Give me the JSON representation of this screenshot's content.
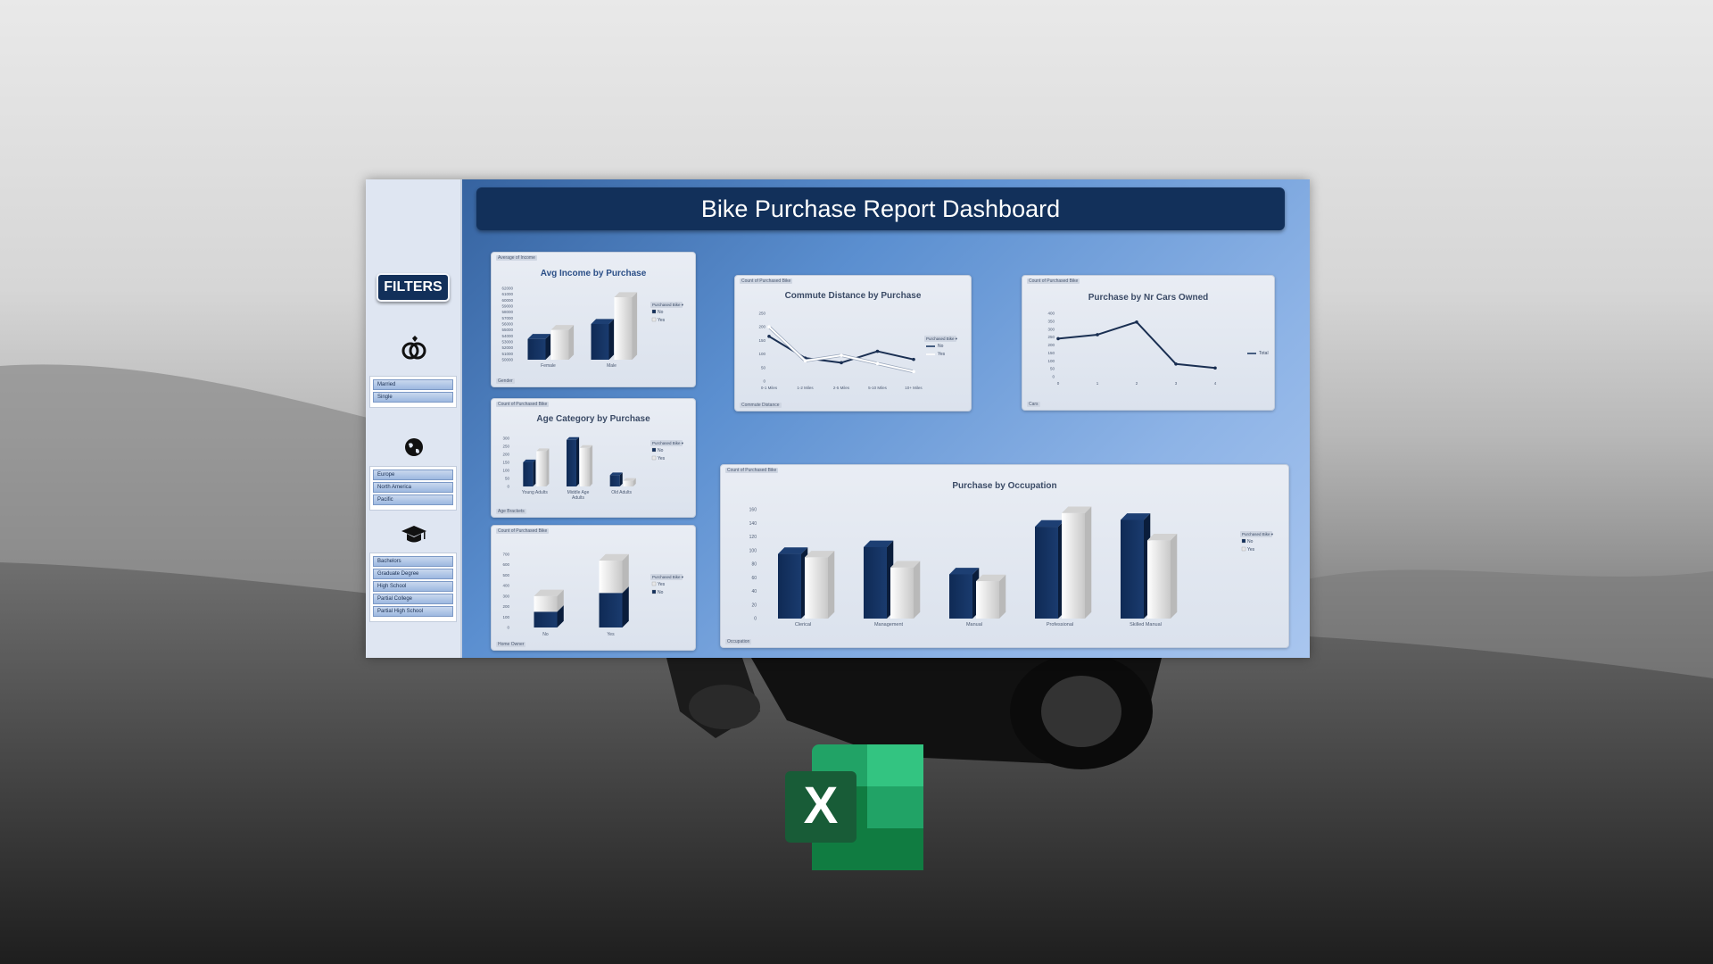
{
  "dashboard": {
    "title": "Bike Purchase Report Dashboard",
    "filters_label": "FILTERS"
  },
  "slicers": {
    "marital": [
      "Married",
      "Single"
    ],
    "region": [
      "Europe",
      "North America",
      "Pacific"
    ],
    "education": [
      "Bachelors",
      "Graduate Degree",
      "High School",
      "Partial College",
      "Partial High School"
    ]
  },
  "icons": {
    "marital": "rings-icon",
    "region": "globe-icon",
    "education": "graduation-cap-icon",
    "app": "excel-logo-icon"
  },
  "colors": {
    "navy": "#12305a",
    "bar_no": "#13305c",
    "bar_yes": "#e8e8e8"
  },
  "cards": {
    "income": {
      "title": "Avg Income by Purchase",
      "field": "Average of Income",
      "axis_button": "Gender",
      "legend_title": "Purchased Bike",
      "legend": [
        "No",
        "Yes"
      ]
    },
    "age": {
      "title": "Age Category by Purchase",
      "field": "Count of Purchased Bike",
      "axis_button": "Age Brackets",
      "legend_title": "Purchased Bike",
      "legend": [
        "No",
        "Yes"
      ]
    },
    "home": {
      "field": "Count of Purchased Bike",
      "axis_button": "Home Owner",
      "legend_title": "Purchased Bike",
      "legend": [
        "Yes",
        "No"
      ]
    },
    "commute": {
      "title": "Commute Distance by Purchase",
      "field": "Count of Purchased Bike",
      "axis_button": "Commute Distance",
      "legend_title": "Purchased Bike",
      "legend": [
        "No",
        "Yes"
      ]
    },
    "cars": {
      "title": "Purchase by Nr Cars Owned",
      "field": "Count of Purchased Bike",
      "axis_button": "Cars",
      "legend": [
        "Total"
      ]
    },
    "occupation": {
      "title": "Purchase by Occupation",
      "field": "Count of Purchased Bike",
      "axis_button": "Occupation",
      "legend_title": "Purchased Bike",
      "legend": [
        "No",
        "Yes"
      ]
    }
  },
  "chart_data": [
    {
      "id": "income",
      "type": "bar",
      "title": "Avg Income by Purchase",
      "categories": [
        "Female",
        "Male"
      ],
      "series": [
        {
          "name": "No",
          "values": [
            53500,
            56000
          ]
        },
        {
          "name": "Yes",
          "values": [
            55000,
            60500
          ]
        }
      ],
      "ylim": [
        50000,
        62000
      ],
      "yticks": [
        "50000",
        "51000",
        "52000",
        "53000",
        "54000",
        "55000",
        "56000",
        "57000",
        "58000",
        "59000",
        "60000",
        "61000",
        "62000"
      ]
    },
    {
      "id": "age",
      "type": "bar",
      "title": "Age Category by Purchase",
      "categories": [
        "Young Adults",
        "Middle Age Adults",
        "Old Adults"
      ],
      "series": [
        {
          "name": "No",
          "values": [
            150,
            290,
            70
          ]
        },
        {
          "name": "Yes",
          "values": [
            220,
            240,
            35
          ]
        }
      ],
      "ylim": [
        0,
        300
      ],
      "yticks": [
        "0",
        "50",
        "100",
        "150",
        "200",
        "250",
        "300"
      ]
    },
    {
      "id": "home",
      "type": "bar",
      "stacked": true,
      "categories": [
        "No",
        "Yes"
      ],
      "series": [
        {
          "name": "No",
          "values": [
            150,
            330
          ]
        },
        {
          "name": "Yes",
          "values": [
            150,
            310
          ]
        }
      ],
      "ylim": [
        0,
        700
      ],
      "yticks": [
        "0",
        "100",
        "200",
        "300",
        "400",
        "500",
        "600",
        "700"
      ]
    },
    {
      "id": "commute",
      "type": "line",
      "title": "Commute Distance by Purchase",
      "categories": [
        "0-1 Miles",
        "1-2 Miles",
        "2-5 Miles",
        "5-10 Miles",
        "10+ Miles"
      ],
      "series": [
        {
          "name": "No",
          "values": [
            165,
            85,
            68,
            110,
            80
          ]
        },
        {
          "name": "Yes",
          "values": [
            200,
            75,
            95,
            65,
            35
          ]
        }
      ],
      "ylim": [
        0,
        250
      ],
      "yticks": [
        "0",
        "50",
        "100",
        "150",
        "200",
        "250"
      ]
    },
    {
      "id": "cars",
      "type": "line",
      "title": "Purchase by Nr Cars Owned",
      "categories": [
        "0",
        "1",
        "2",
        "3",
        "4"
      ],
      "series": [
        {
          "name": "Total",
          "values": [
            240,
            265,
            345,
            80,
            55
          ]
        }
      ],
      "ylim": [
        0,
        400
      ],
      "yticks": [
        "0",
        "50",
        "100",
        "150",
        "200",
        "250",
        "300",
        "350",
        "400"
      ]
    },
    {
      "id": "occupation",
      "type": "bar",
      "title": "Purchase by Occupation",
      "categories": [
        "Clerical",
        "Management",
        "Manual",
        "Professional",
        "Skilled Manual"
      ],
      "series": [
        {
          "name": "No",
          "values": [
            95,
            105,
            65,
            135,
            145
          ]
        },
        {
          "name": "Yes",
          "values": [
            90,
            75,
            55,
            155,
            115
          ]
        }
      ],
      "ylim": [
        0,
        160
      ],
      "yticks": [
        "0",
        "20",
        "40",
        "60",
        "80",
        "100",
        "120",
        "140",
        "160"
      ]
    }
  ]
}
